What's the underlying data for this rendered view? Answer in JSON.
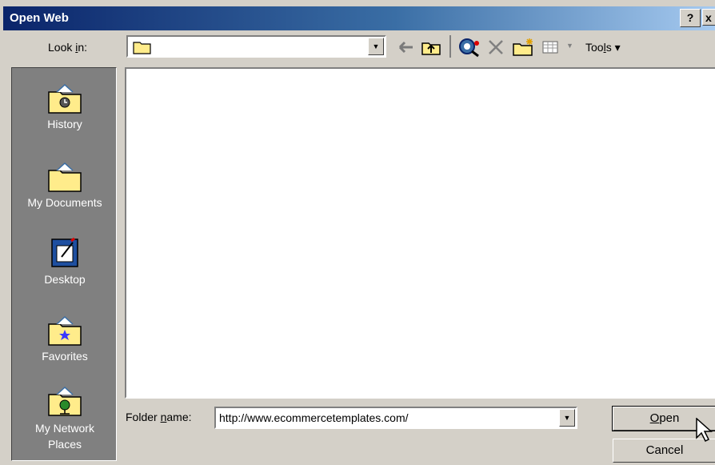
{
  "dialog": {
    "title": "Open Web",
    "help_label": "?",
    "close_label": "x"
  },
  "lookin": {
    "label_pre": "Look ",
    "label_u": "i",
    "label_post": "n:",
    "value": ""
  },
  "toolbar": {
    "tools_pre": "Too",
    "tools_u": "l",
    "tools_post": "s ▾"
  },
  "places": [
    {
      "label": "History",
      "icon": "history-folder-icon"
    },
    {
      "label": "My Documents",
      "icon": "my-documents-folder-icon"
    },
    {
      "label": "Desktop",
      "icon": "desktop-icon"
    },
    {
      "label": "Favorites",
      "icon": "favorites-folder-icon"
    },
    {
      "label": "My Network\nPlaces",
      "icon": "network-places-icon"
    }
  ],
  "folder_name": {
    "label_pre": "Folder ",
    "label_u": "n",
    "label_post": "ame:",
    "value": "http://www.ecommercetemplates.com/"
  },
  "buttons": {
    "open_u": "O",
    "open_post": "pen",
    "cancel": "Cancel"
  },
  "colors": {
    "title_start": "#0a246a",
    "title_end": "#a6caf0",
    "dialog_bg": "#d4d0c8",
    "places_bg": "#808080"
  }
}
